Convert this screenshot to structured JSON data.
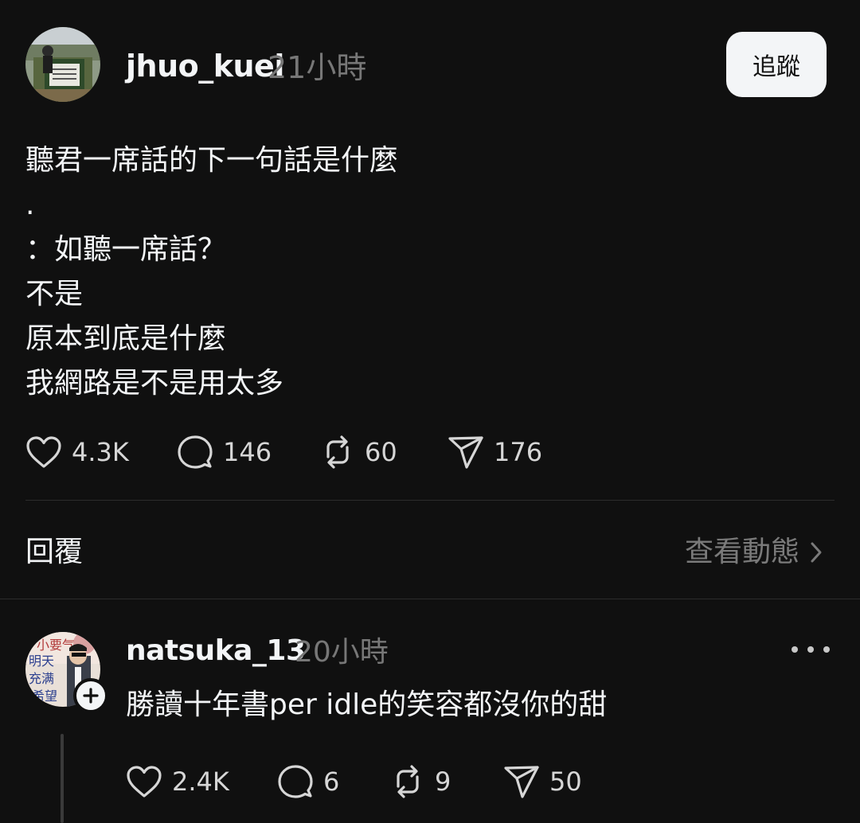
{
  "post": {
    "username": "jhuo_kuei",
    "time": "21小時",
    "follow_label": "追蹤",
    "lines": [
      "聽君一席話的下一句話是什麼",
      ".",
      "：如聽一席話？",
      "不是",
      "原本到底是什麼",
      "我網路是不是用太多"
    ],
    "likes": "4.3K",
    "comments": "146",
    "reposts": "60",
    "shares": "176"
  },
  "replies_section": {
    "title": "回覆",
    "view_activity": "查看動態"
  },
  "reply": {
    "username": "natsuka_13",
    "time": "20小時",
    "text": "勝讀十年書per idle的笑容都沒你的甜",
    "likes": "2.4K",
    "comments": "6",
    "reposts": "9",
    "shares": "50"
  },
  "colors": {
    "background": "#101010",
    "text": "#f3f5f7",
    "muted": "#777777",
    "divider": "#2c2c2c"
  },
  "icons": [
    "heart-icon",
    "comment-icon",
    "repost-icon",
    "share-icon",
    "chevron-right-icon",
    "more-icon",
    "plus-icon"
  ]
}
